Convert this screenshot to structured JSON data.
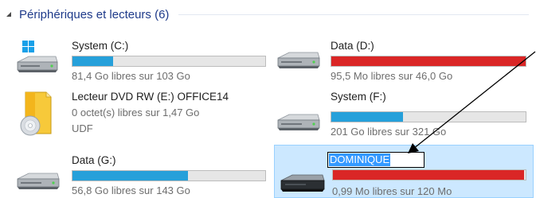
{
  "group": {
    "title": "Périphériques et lecteurs (6)"
  },
  "drives": [
    {
      "name": "System (C:)",
      "free_text": "81,4 Go libres sur 103 Go",
      "used_fraction": 0.21,
      "bar_color": "#26a0da",
      "icon": "windows-drive-icon"
    },
    {
      "name": "Data (D:)",
      "free_text": "95,5 Mo libres sur 46,0 Go",
      "used_fraction": 0.998,
      "bar_color": "#da2626",
      "icon": "hard-drive-icon"
    },
    {
      "name": "Lecteur DVD RW (E:) OFFICE14",
      "free_text": "0 octet(s) libres sur 1,47 Go",
      "filesystem": "UDF",
      "icon": "dvd-drive-icon"
    },
    {
      "name": "System (F:)",
      "free_text": "201 Go libres sur 321 Go",
      "used_fraction": 0.37,
      "bar_color": "#26a0da",
      "icon": "hard-drive-icon"
    },
    {
      "name": "Data (G:)",
      "free_text": "56,8 Go libres sur 143 Go",
      "used_fraction": 0.6,
      "bar_color": "#26a0da",
      "icon": "hard-drive-icon"
    },
    {
      "name": "DOMINIQUE",
      "free_text": "0,99 Mo libres sur 120 Mo",
      "used_fraction": 0.992,
      "bar_color": "#da2626",
      "icon": "usb-drive-icon",
      "selected": true,
      "renaming": true
    }
  ]
}
